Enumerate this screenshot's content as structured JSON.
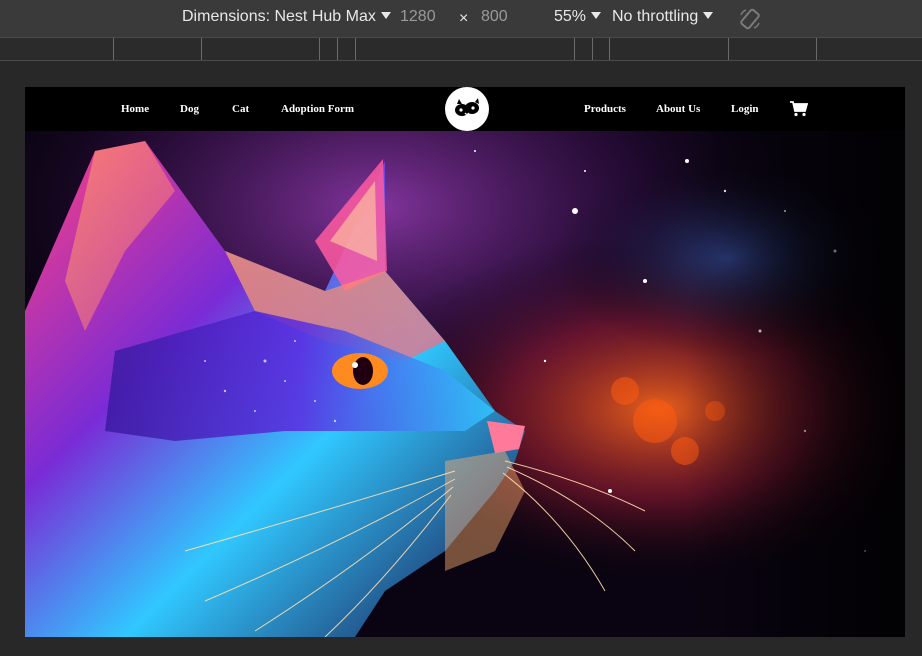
{
  "devtools": {
    "device_label": "Dimensions: Nest Hub Max",
    "width": "1280",
    "times": "×",
    "height": "800",
    "zoom": "55%",
    "throttling": "No throttling",
    "rotate_icon": "rotate-icon"
  },
  "site": {
    "nav_left": [
      "Home",
      "Dog",
      "Cat",
      "Adoption Form"
    ],
    "nav_right": [
      "Products",
      "About Us",
      "Login"
    ],
    "logo_icon": "pet-logo-icon",
    "cart_icon": "shopping-cart-icon"
  },
  "colors": {
    "toolbar_bg": "#3a3a3a",
    "page_bg": "#282828",
    "nav_bg": "#000000",
    "accent_purple": "#7a2bd6",
    "accent_cyan": "#30c8ff",
    "accent_orange": "#ff6a1a"
  }
}
